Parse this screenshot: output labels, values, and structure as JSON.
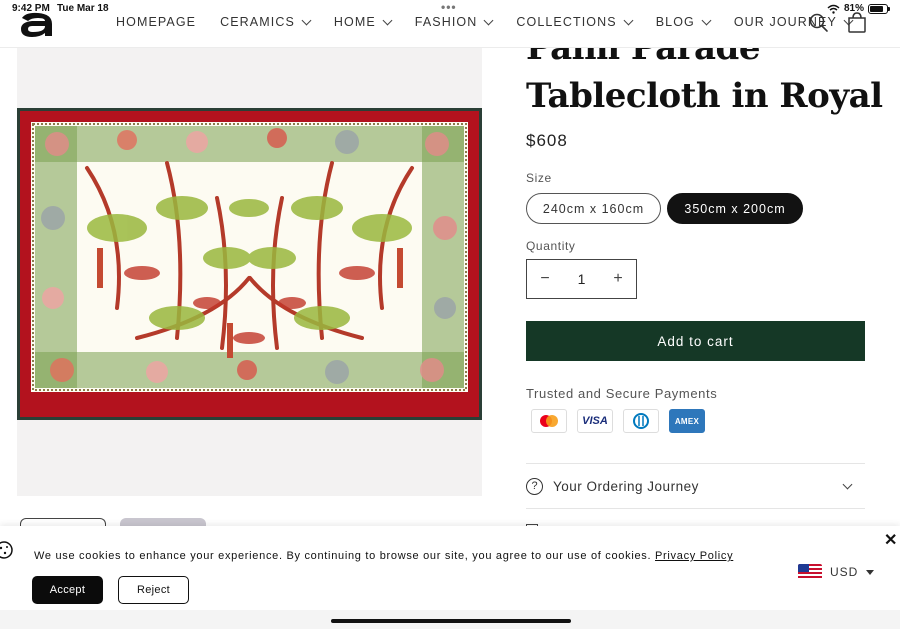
{
  "status_bar": {
    "time": "9:42 PM",
    "date": "Tue Mar 18",
    "battery": "81%",
    "battery_level": 0.81
  },
  "header": {
    "nav": [
      {
        "label": "HOMEPAGE",
        "has_dropdown": false
      },
      {
        "label": "CERAMICS",
        "has_dropdown": true
      },
      {
        "label": "HOME",
        "has_dropdown": true
      },
      {
        "label": "FASHION",
        "has_dropdown": true
      },
      {
        "label": "COLLECTIONS",
        "has_dropdown": true
      },
      {
        "label": "BLOG",
        "has_dropdown": true
      },
      {
        "label": "OUR JOURNEY",
        "has_dropdown": true
      }
    ]
  },
  "product": {
    "title_line1": "Palm Parade",
    "title_line2": "Tablecloth in Royal",
    "price": "$608",
    "size_label": "Size",
    "sizes": [
      {
        "label": "240cm x 160cm",
        "selected": false
      },
      {
        "label": "350cm x 200cm",
        "selected": true
      }
    ],
    "quantity_label": "Quantity",
    "quantity": "1",
    "minus": "−",
    "plus": "+",
    "add_to_cart": "Add to cart",
    "trusted_label": "Trusted and Secure Payments",
    "payments": {
      "visa": "VISA",
      "amex": "AMEX"
    },
    "accordion": {
      "icon": "?",
      "label": "Your Ordering Journey"
    }
  },
  "cookie": {
    "message": "We use cookies to enhance your experience. By continuing to browse our site, you agree to our use of cookies.",
    "policy_link": "Privacy Policy",
    "accept": "Accept",
    "reject": "Reject",
    "close": "✕",
    "currency": "USD"
  },
  "colors": {
    "add_to_cart_bg": "#153826",
    "selected_size_bg": "#121212",
    "tablecloth_border": "#b3121e",
    "gallery_bg": "#f3f2f2",
    "amex_bg": "#2e77bb"
  }
}
